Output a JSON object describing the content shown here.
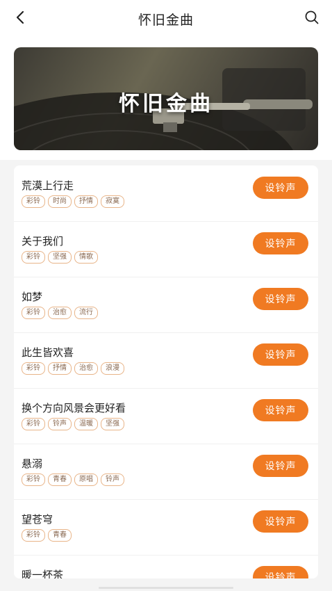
{
  "header": {
    "title": "怀旧金曲",
    "back_icon": "back-arrow-icon",
    "search_icon": "search-icon"
  },
  "banner": {
    "title": "怀旧金曲"
  },
  "colors": {
    "accent": "#f07a22",
    "tag_border": "#e8b488"
  },
  "songs": [
    {
      "title": "荒漠上行走",
      "tags": [
        "彩铃",
        "时尚",
        "抒情",
        "寂寞"
      ],
      "button": "设铃声"
    },
    {
      "title": "关于我们",
      "tags": [
        "彩铃",
        "坚强",
        "情歌"
      ],
      "button": "设铃声"
    },
    {
      "title": "如梦",
      "tags": [
        "彩铃",
        "治愈",
        "流行"
      ],
      "button": "设铃声"
    },
    {
      "title": "此生皆欢喜",
      "tags": [
        "彩铃",
        "抒情",
        "治愈",
        "浪漫"
      ],
      "button": "设铃声"
    },
    {
      "title": "换个方向风景会更好看",
      "tags": [
        "彩铃",
        "铃声",
        "温暖",
        "坚强"
      ],
      "button": "设铃声"
    },
    {
      "title": "悬溺",
      "tags": [
        "彩铃",
        "青春",
        "原唱",
        "铃声"
      ],
      "button": "设铃声"
    },
    {
      "title": "望苍穹",
      "tags": [
        "彩铃",
        "青春"
      ],
      "button": "设铃声"
    },
    {
      "title": "暖一杯茶",
      "tags": [],
      "button": "设铃声"
    }
  ]
}
